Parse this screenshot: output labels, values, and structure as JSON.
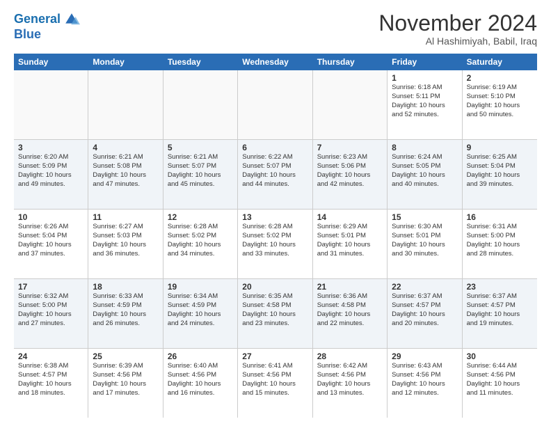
{
  "logo": {
    "line1": "General",
    "line2": "Blue"
  },
  "title": "November 2024",
  "location": "Al Hashimiyah, Babil, Iraq",
  "headers": [
    "Sunday",
    "Monday",
    "Tuesday",
    "Wednesday",
    "Thursday",
    "Friday",
    "Saturday"
  ],
  "rows": [
    [
      {
        "day": "",
        "text": "",
        "empty": true
      },
      {
        "day": "",
        "text": "",
        "empty": true
      },
      {
        "day": "",
        "text": "",
        "empty": true
      },
      {
        "day": "",
        "text": "",
        "empty": true
      },
      {
        "day": "",
        "text": "",
        "empty": true
      },
      {
        "day": "1",
        "text": "Sunrise: 6:18 AM\nSunset: 5:11 PM\nDaylight: 10 hours\nand 52 minutes."
      },
      {
        "day": "2",
        "text": "Sunrise: 6:19 AM\nSunset: 5:10 PM\nDaylight: 10 hours\nand 50 minutes."
      }
    ],
    [
      {
        "day": "3",
        "text": "Sunrise: 6:20 AM\nSunset: 5:09 PM\nDaylight: 10 hours\nand 49 minutes."
      },
      {
        "day": "4",
        "text": "Sunrise: 6:21 AM\nSunset: 5:08 PM\nDaylight: 10 hours\nand 47 minutes."
      },
      {
        "day": "5",
        "text": "Sunrise: 6:21 AM\nSunset: 5:07 PM\nDaylight: 10 hours\nand 45 minutes."
      },
      {
        "day": "6",
        "text": "Sunrise: 6:22 AM\nSunset: 5:07 PM\nDaylight: 10 hours\nand 44 minutes."
      },
      {
        "day": "7",
        "text": "Sunrise: 6:23 AM\nSunset: 5:06 PM\nDaylight: 10 hours\nand 42 minutes."
      },
      {
        "day": "8",
        "text": "Sunrise: 6:24 AM\nSunset: 5:05 PM\nDaylight: 10 hours\nand 40 minutes."
      },
      {
        "day": "9",
        "text": "Sunrise: 6:25 AM\nSunset: 5:04 PM\nDaylight: 10 hours\nand 39 minutes."
      }
    ],
    [
      {
        "day": "10",
        "text": "Sunrise: 6:26 AM\nSunset: 5:04 PM\nDaylight: 10 hours\nand 37 minutes."
      },
      {
        "day": "11",
        "text": "Sunrise: 6:27 AM\nSunset: 5:03 PM\nDaylight: 10 hours\nand 36 minutes."
      },
      {
        "day": "12",
        "text": "Sunrise: 6:28 AM\nSunset: 5:02 PM\nDaylight: 10 hours\nand 34 minutes."
      },
      {
        "day": "13",
        "text": "Sunrise: 6:28 AM\nSunset: 5:02 PM\nDaylight: 10 hours\nand 33 minutes."
      },
      {
        "day": "14",
        "text": "Sunrise: 6:29 AM\nSunset: 5:01 PM\nDaylight: 10 hours\nand 31 minutes."
      },
      {
        "day": "15",
        "text": "Sunrise: 6:30 AM\nSunset: 5:01 PM\nDaylight: 10 hours\nand 30 minutes."
      },
      {
        "day": "16",
        "text": "Sunrise: 6:31 AM\nSunset: 5:00 PM\nDaylight: 10 hours\nand 28 minutes."
      }
    ],
    [
      {
        "day": "17",
        "text": "Sunrise: 6:32 AM\nSunset: 5:00 PM\nDaylight: 10 hours\nand 27 minutes."
      },
      {
        "day": "18",
        "text": "Sunrise: 6:33 AM\nSunset: 4:59 PM\nDaylight: 10 hours\nand 26 minutes."
      },
      {
        "day": "19",
        "text": "Sunrise: 6:34 AM\nSunset: 4:59 PM\nDaylight: 10 hours\nand 24 minutes."
      },
      {
        "day": "20",
        "text": "Sunrise: 6:35 AM\nSunset: 4:58 PM\nDaylight: 10 hours\nand 23 minutes."
      },
      {
        "day": "21",
        "text": "Sunrise: 6:36 AM\nSunset: 4:58 PM\nDaylight: 10 hours\nand 22 minutes."
      },
      {
        "day": "22",
        "text": "Sunrise: 6:37 AM\nSunset: 4:57 PM\nDaylight: 10 hours\nand 20 minutes."
      },
      {
        "day": "23",
        "text": "Sunrise: 6:37 AM\nSunset: 4:57 PM\nDaylight: 10 hours\nand 19 minutes."
      }
    ],
    [
      {
        "day": "24",
        "text": "Sunrise: 6:38 AM\nSunset: 4:57 PM\nDaylight: 10 hours\nand 18 minutes."
      },
      {
        "day": "25",
        "text": "Sunrise: 6:39 AM\nSunset: 4:56 PM\nDaylight: 10 hours\nand 17 minutes."
      },
      {
        "day": "26",
        "text": "Sunrise: 6:40 AM\nSunset: 4:56 PM\nDaylight: 10 hours\nand 16 minutes."
      },
      {
        "day": "27",
        "text": "Sunrise: 6:41 AM\nSunset: 4:56 PM\nDaylight: 10 hours\nand 15 minutes."
      },
      {
        "day": "28",
        "text": "Sunrise: 6:42 AM\nSunset: 4:56 PM\nDaylight: 10 hours\nand 13 minutes."
      },
      {
        "day": "29",
        "text": "Sunrise: 6:43 AM\nSunset: 4:56 PM\nDaylight: 10 hours\nand 12 minutes."
      },
      {
        "day": "30",
        "text": "Sunrise: 6:44 AM\nSunset: 4:56 PM\nDaylight: 10 hours\nand 11 minutes."
      }
    ]
  ]
}
